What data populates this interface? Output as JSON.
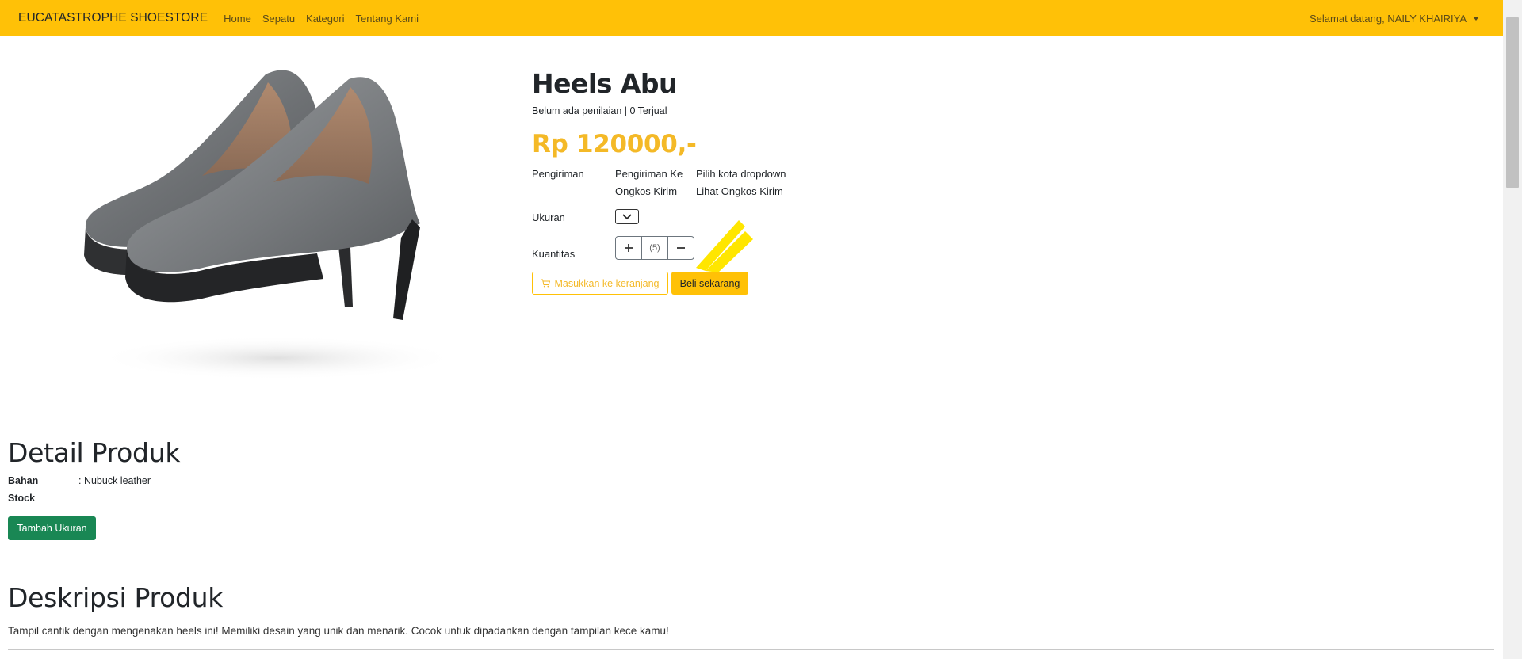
{
  "navbar": {
    "brand": "EUCATASTROPHE SHOESTORE",
    "links": [
      "Home",
      "Sepatu",
      "Kategori",
      "Tentang Kami"
    ],
    "user_greeting": "Selamat datang, NAILY KHAIRIYA"
  },
  "product": {
    "title": "Heels Abu",
    "rating_text": "Belum ada penilaian | 0 Terjual",
    "price": "Rp 120000,-",
    "shipping_label": "Pengiriman",
    "shipping_to": "Pengiriman Ke",
    "shipping_city": "Pilih kota dropdown",
    "shipping_cost_label": "Ongkos Kirim",
    "shipping_cost_link": "Lihat Ongkos Kirim",
    "size_label": "Ukuran",
    "quantity_label": "Kuantitas",
    "quantity_value": "(5)",
    "add_to_cart": "Masukkan ke keranjang",
    "buy_now": "Beli sekarang"
  },
  "detail": {
    "title": "Detail Produk",
    "material_key": "Bahan",
    "material_value": ": Nubuck leather",
    "stock_key": "Stock",
    "add_size_button": "Tambah Ukuran"
  },
  "description": {
    "title": "Deskripsi Produk",
    "text": "Tampil cantik dengan mengenakan heels ini! Memiliki desain yang unik dan menarik. Cocok untuk dipadankan dengan tampilan kece kamu!"
  },
  "colors": {
    "navbar": "#ffc107",
    "price": "#f4b927",
    "success": "#198754"
  }
}
